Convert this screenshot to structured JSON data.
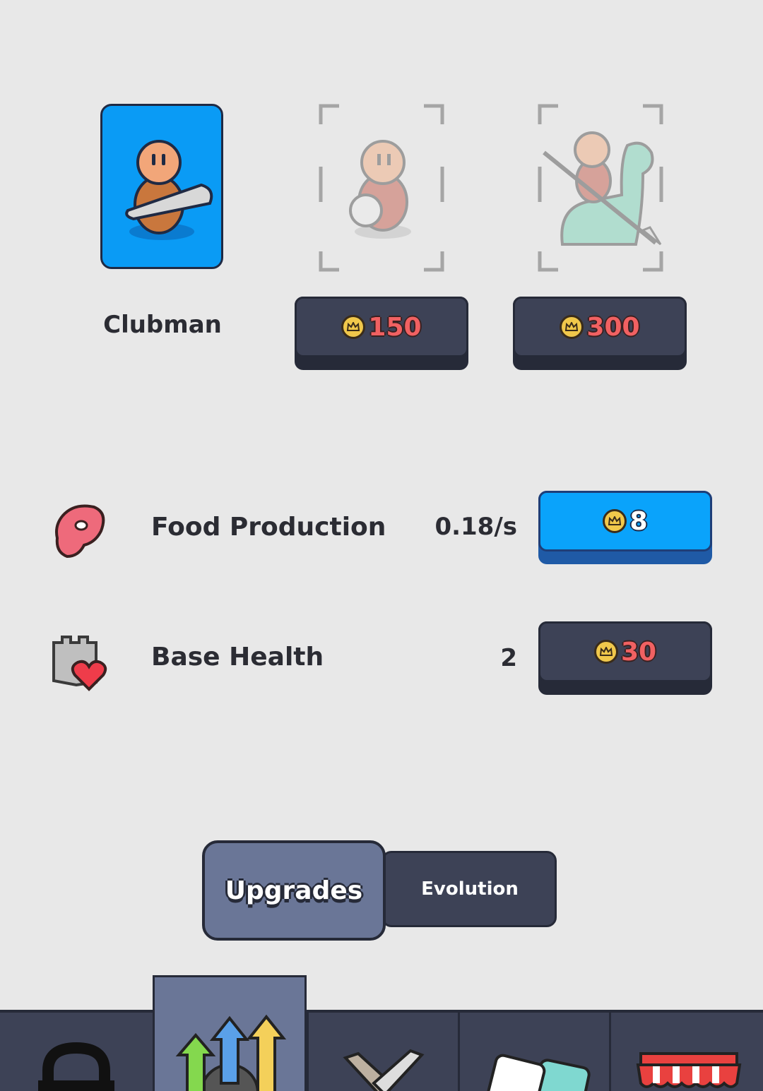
{
  "units": [
    {
      "name": "Clubman",
      "state": "owned",
      "icon": "clubman-icon"
    },
    {
      "price": "150",
      "state": "locked",
      "icon": "slinger-icon"
    },
    {
      "price": "300",
      "state": "locked",
      "icon": "dino-rider-icon"
    }
  ],
  "upgrades": [
    {
      "label": "Food Production",
      "value": "0.18/s",
      "cost": "8",
      "icon": "meat-icon"
    },
    {
      "label": "Base Health",
      "value": "2",
      "cost": "30",
      "icon": "castle-heart-icon"
    }
  ],
  "tabs": {
    "active": "Upgrades",
    "other": "Evolution"
  },
  "nav": [
    {
      "icon": "lock-icon"
    },
    {
      "icon": "upgrade-arrows-icon",
      "active": true
    },
    {
      "icon": "crossed-swords-icon"
    },
    {
      "icon": "cards-icon"
    },
    {
      "icon": "shop-awning-icon"
    }
  ],
  "colors": {
    "background": "#e8e8e8",
    "accent_blue": "#0aa3fb",
    "button_dark": "#3d4256",
    "price_red": "#f16162",
    "coin_gold": "#f1c84b"
  }
}
